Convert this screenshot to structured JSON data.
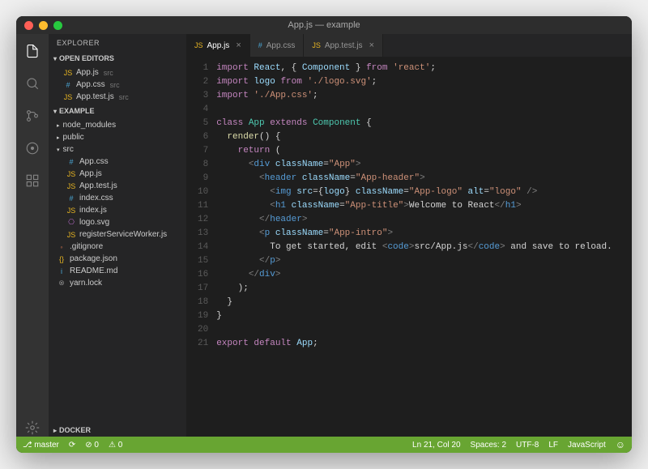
{
  "window": {
    "title": "App.js — example"
  },
  "sidebar": {
    "header": "EXPLORER",
    "sections": {
      "openEditors": {
        "label": "OPEN EDITORS"
      },
      "project": {
        "label": "EXAMPLE"
      },
      "docker": {
        "label": "DOCKER"
      }
    },
    "openEditors": [
      {
        "icon": "JS",
        "cls": "js",
        "name": "App.js",
        "dir": "src"
      },
      {
        "icon": "#",
        "cls": "css",
        "name": "App.css",
        "dir": "src"
      },
      {
        "icon": "JS",
        "cls": "js",
        "name": "App.test.js",
        "dir": "src"
      }
    ],
    "tree": [
      {
        "type": "folder",
        "open": false,
        "name": "node_modules",
        "depth": 0
      },
      {
        "type": "folder",
        "open": false,
        "name": "public",
        "depth": 0
      },
      {
        "type": "folder",
        "open": true,
        "name": "src",
        "depth": 0
      },
      {
        "type": "file",
        "icon": "#",
        "cls": "css",
        "name": "App.css",
        "depth": 1
      },
      {
        "type": "file",
        "icon": "JS",
        "cls": "js",
        "name": "App.js",
        "depth": 1
      },
      {
        "type": "file",
        "icon": "JS",
        "cls": "js",
        "name": "App.test.js",
        "depth": 1
      },
      {
        "type": "file",
        "icon": "#",
        "cls": "css",
        "name": "index.css",
        "depth": 1
      },
      {
        "type": "file",
        "icon": "JS",
        "cls": "js",
        "name": "index.js",
        "depth": 1
      },
      {
        "type": "file",
        "icon": "⎔",
        "cls": "svg",
        "name": "logo.svg",
        "depth": 1
      },
      {
        "type": "file",
        "icon": "JS",
        "cls": "js",
        "name": "registerServiceWorker.js",
        "depth": 1
      },
      {
        "type": "file",
        "icon": "◦",
        "cls": "git",
        "name": ".gitignore",
        "depth": 0
      },
      {
        "type": "file",
        "icon": "{}",
        "cls": "json",
        "name": "package.json",
        "depth": 0
      },
      {
        "type": "file",
        "icon": "i",
        "cls": "md",
        "name": "README.md",
        "depth": 0
      },
      {
        "type": "file",
        "icon": "⊗",
        "cls": "lock",
        "name": "yarn.lock",
        "depth": 0
      }
    ]
  },
  "tabs": [
    {
      "icon": "JS",
      "cls": "js",
      "name": "App.js",
      "active": true,
      "close": true
    },
    {
      "icon": "#",
      "cls": "css",
      "name": "App.css",
      "active": false,
      "close": false
    },
    {
      "icon": "JS",
      "cls": "js",
      "name": "App.test.js",
      "active": false,
      "close": true
    }
  ],
  "code": {
    "lines": [
      "<span class='c-kw'>import</span> <span class='c-var'>React</span>, { <span class='c-var'>Component</span> } <span class='c-kw'>from</span> <span class='c-str'>'react'</span>;",
      "<span class='c-kw'>import</span> <span class='c-var'>logo</span> <span class='c-kw'>from</span> <span class='c-str'>'./logo.svg'</span>;",
      "<span class='c-kw'>import</span> <span class='c-str'>'./App.css'</span>;",
      "",
      "<span class='c-kw'>class</span> <span class='c-comp'>App</span> <span class='c-kw'>extends</span> <span class='c-comp'>Component</span> {",
      "  <span class='c-fn'>render</span>() {",
      "    <span class='c-kw'>return</span> (",
      "      <span class='c-tag'>&lt;</span><span class='c-name'>div</span> <span class='c-attr'>className</span>=<span class='c-str'>\"App\"</span><span class='c-tag'>&gt;</span>",
      "        <span class='c-tag'>&lt;</span><span class='c-name'>header</span> <span class='c-attr'>className</span>=<span class='c-str'>\"App-header\"</span><span class='c-tag'>&gt;</span>",
      "          <span class='c-tag'>&lt;</span><span class='c-name'>img</span> <span class='c-attr'>src</span>={<span class='c-var'>logo</span>} <span class='c-attr'>className</span>=<span class='c-str'>\"App-logo\"</span> <span class='c-attr'>alt</span>=<span class='c-str'>\"logo\"</span> <span class='c-tag'>/&gt;</span>",
      "          <span class='c-tag'>&lt;</span><span class='c-name'>h1</span> <span class='c-attr'>className</span>=<span class='c-str'>\"App-title\"</span><span class='c-tag'>&gt;</span>Welcome to React<span class='c-tag'>&lt;/</span><span class='c-name'>h1</span><span class='c-tag'>&gt;</span>",
      "        <span class='c-tag'>&lt;/</span><span class='c-name'>header</span><span class='c-tag'>&gt;</span>",
      "        <span class='c-tag'>&lt;</span><span class='c-name'>p</span> <span class='c-attr'>className</span>=<span class='c-str'>\"App-intro\"</span><span class='c-tag'>&gt;</span>",
      "          To get started, edit <span class='c-tag'>&lt;</span><span class='c-name'>code</span><span class='c-tag'>&gt;</span>src/App.js<span class='c-tag'>&lt;/</span><span class='c-name'>code</span><span class='c-tag'>&gt;</span> and save to reload.",
      "        <span class='c-tag'>&lt;/</span><span class='c-name'>p</span><span class='c-tag'>&gt;</span>",
      "      <span class='c-tag'>&lt;/</span><span class='c-name'>div</span><span class='c-tag'>&gt;</span>",
      "    );",
      "  }",
      "}",
      "",
      "<span class='c-kw'>export</span> <span class='c-kw'>default</span> <span class='c-var'>App</span>;"
    ]
  },
  "status": {
    "branch": "⎇ master",
    "sync": "⟳",
    "errors": "⊘ 0",
    "warnings": "⚠ 0",
    "cursor": "Ln 21, Col 20",
    "spaces": "Spaces: 2",
    "encoding": "UTF-8",
    "eol": "LF",
    "language": "JavaScript"
  }
}
